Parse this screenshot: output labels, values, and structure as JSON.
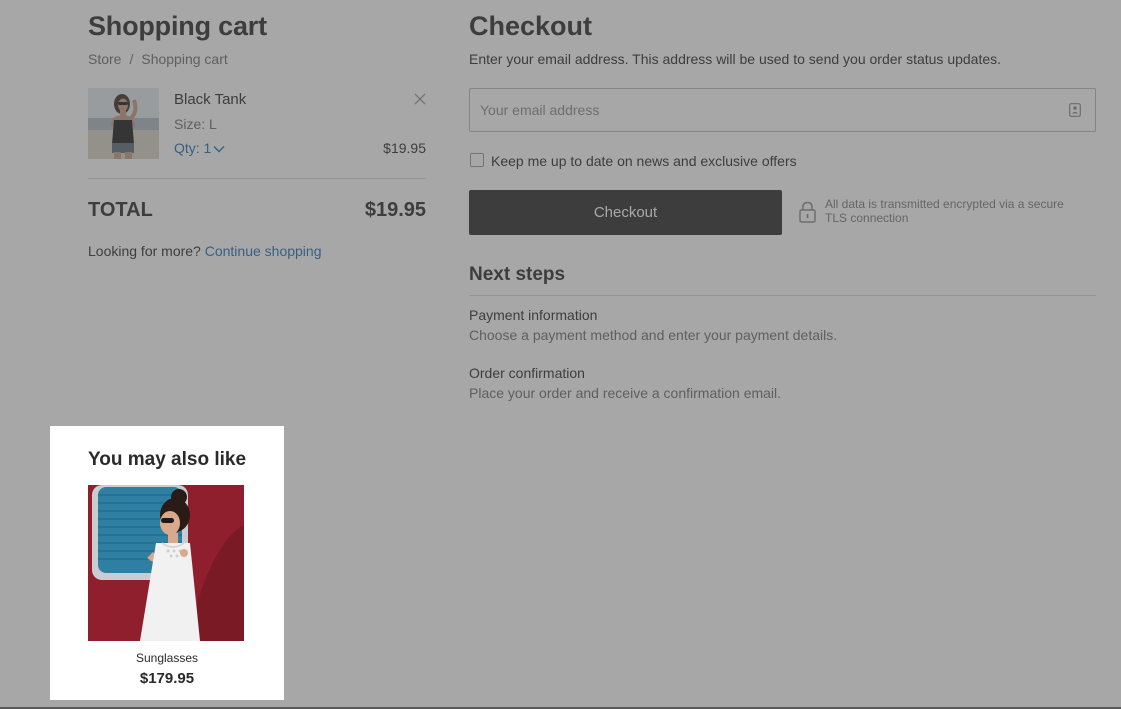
{
  "cart": {
    "title": "Shopping cart",
    "breadcrumb": {
      "store": "Store",
      "separator": "/",
      "current": "Shopping cart"
    },
    "item": {
      "name": "Black Tank",
      "size": "Size: L",
      "qty": "Qty: 1",
      "price": "$19.95",
      "thumb_icon": "black-tank-model-photo",
      "remove_icon": "close-icon"
    },
    "total_label": "TOTAL",
    "total_value": "$19.95",
    "more_prefix": "Looking for more?",
    "continue_link": "Continue shopping"
  },
  "checkout": {
    "title": "Checkout",
    "subtitle": "Enter your email address. This address will be used to send you order status updates.",
    "email_placeholder": "Your email address",
    "email_value": "",
    "email_icon": "contact-card-icon",
    "newsletter_label": "Keep me up to date on news and exclusive offers",
    "newsletter_checked": false,
    "button_label": "Checkout",
    "secure_icon": "lock-icon",
    "secure_note": "All data is transmitted encrypted via a secure TLS connection",
    "next_steps_title": "Next steps",
    "steps": [
      {
        "title": "Payment information",
        "description": "Choose a payment method and enter your payment details."
      },
      {
        "title": "Order confirmation",
        "description": "Place your order and receive a confirmation email."
      }
    ]
  },
  "recommendations": {
    "title": "You may also like",
    "product": {
      "name": "Sunglasses",
      "price": "$179.95",
      "image_icon": "sunglasses-model-photo"
    }
  },
  "colors": {
    "link": "#1f6fb2",
    "button": "#2b2b2b",
    "overlay": "rgba(80,80,80,0.5)",
    "text": "#2a2a2a",
    "muted": "#6e6e6e"
  }
}
